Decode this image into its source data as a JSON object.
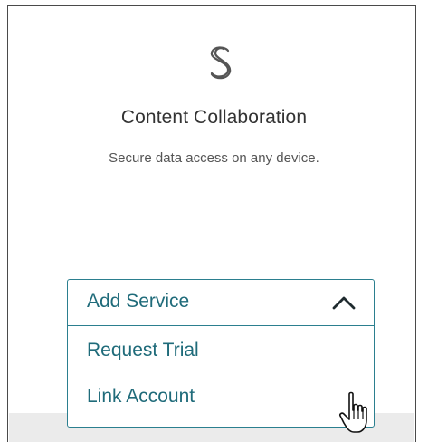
{
  "card": {
    "title": "Content Collaboration",
    "subtitle": "Secure data access on any device."
  },
  "logo": {
    "icon": "content-collaboration-logo-icon",
    "color": "#555555"
  },
  "dropdown": {
    "label": "Add Service",
    "expanded": true,
    "accent_color": "#1f6b7a",
    "options": [
      {
        "label": "Request Trial"
      },
      {
        "label": "Link Account"
      }
    ]
  },
  "cursor": {
    "icon": "hand-pointer-icon"
  }
}
